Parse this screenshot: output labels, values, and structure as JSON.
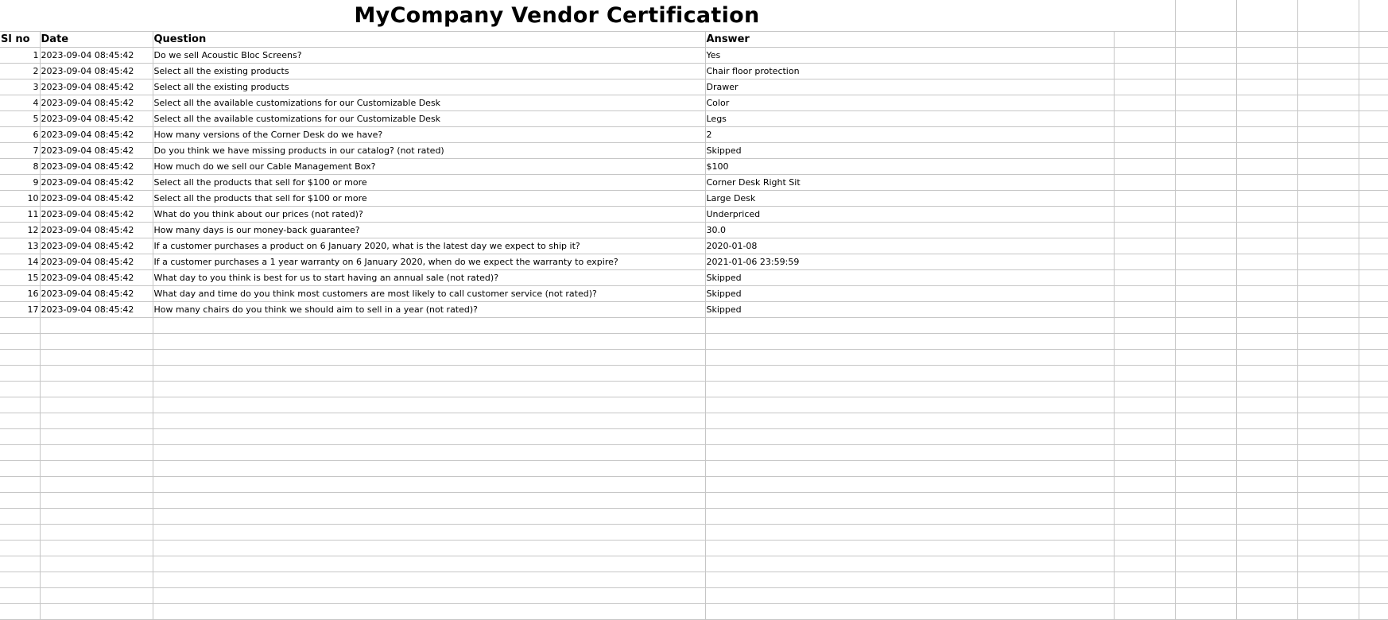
{
  "title": "MyCompany Vendor Certification",
  "headers": {
    "sl_no": "Sl no",
    "date": "Date",
    "question": "Question",
    "answer": "Answer"
  },
  "rows": [
    {
      "sl": "1",
      "date": "2023-09-04 08:45:42",
      "question": "Do we sell Acoustic Bloc Screens?",
      "answer": "Yes"
    },
    {
      "sl": "2",
      "date": "2023-09-04 08:45:42",
      "question": "Select all the existing products",
      "answer": "Chair floor protection"
    },
    {
      "sl": "3",
      "date": "2023-09-04 08:45:42",
      "question": "Select all the existing products",
      "answer": "Drawer"
    },
    {
      "sl": "4",
      "date": "2023-09-04 08:45:42",
      "question": "Select all the available customizations for our Customizable Desk",
      "answer": "Color"
    },
    {
      "sl": "5",
      "date": "2023-09-04 08:45:42",
      "question": "Select all the available customizations for our Customizable Desk",
      "answer": "Legs"
    },
    {
      "sl": "6",
      "date": "2023-09-04 08:45:42",
      "question": "How many versions of the Corner Desk do we have?",
      "answer": "2"
    },
    {
      "sl": "7",
      "date": "2023-09-04 08:45:42",
      "question": "Do you think we have missing products in our catalog? (not rated)",
      "answer": "Skipped"
    },
    {
      "sl": "8",
      "date": "2023-09-04 08:45:42",
      "question": "How much do we sell our Cable Management Box?",
      "answer": "$100"
    },
    {
      "sl": "9",
      "date": "2023-09-04 08:45:42",
      "question": "Select all the products that sell for $100 or more",
      "answer": "Corner Desk Right Sit"
    },
    {
      "sl": "10",
      "date": "2023-09-04 08:45:42",
      "question": "Select all the products that sell for $100 or more",
      "answer": "Large Desk"
    },
    {
      "sl": "11",
      "date": "2023-09-04 08:45:42",
      "question": "What do you think about our prices (not rated)?",
      "answer": "Underpriced"
    },
    {
      "sl": "12",
      "date": "2023-09-04 08:45:42",
      "question": "How many days is our money-back guarantee?",
      "answer": "30.0"
    },
    {
      "sl": "13",
      "date": "2023-09-04 08:45:42",
      "question": "If a customer purchases a product on 6 January 2020, what is the latest day we expect to ship it?",
      "answer": "2020-01-08"
    },
    {
      "sl": "14",
      "date": "2023-09-04 08:45:42",
      "question": "If a customer purchases a 1 year warranty on 6 January 2020, when do we expect the warranty to expire?",
      "answer": "2021-01-06 23:59:59"
    },
    {
      "sl": "15",
      "date": "2023-09-04 08:45:42",
      "question": "What day to you think is best for us to start having an annual sale (not rated)?",
      "answer": "Skipped"
    },
    {
      "sl": "16",
      "date": "2023-09-04 08:45:42",
      "question": "What day and time do you think most customers are most likely to call customer service (not rated)?",
      "answer": "Skipped"
    },
    {
      "sl": "17",
      "date": "2023-09-04 08:45:42",
      "question": "How many chairs do you think we should aim to sell in a year (not rated)?",
      "answer": "Skipped"
    }
  ],
  "colors": {
    "gridline": "#c6c6c6",
    "background": "#ffffff",
    "text": "#000000"
  }
}
